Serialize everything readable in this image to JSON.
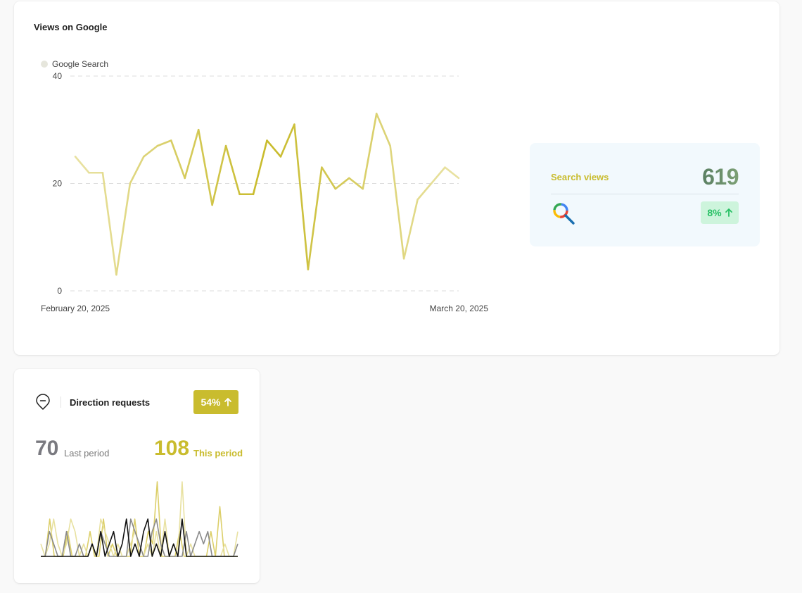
{
  "views_card": {
    "title": "Views on Google",
    "legend": "Google Search",
    "search_views_label": "Search views",
    "search_views_value": "619",
    "change_percent": "8%",
    "change_direction": "up-arrow-icon"
  },
  "direction_card": {
    "title": "Direction requests",
    "change_percent": "54%",
    "change_direction": "up-arrow-icon",
    "last_period_value": "70",
    "last_period_label": "Last period",
    "this_period_value": "108",
    "this_period_label": "This period",
    "icon": "map-pin-icon"
  },
  "colors": {
    "accent": "#c9bc2e",
    "accent_light": "#e8e1a0",
    "accent_mid": "#dccf6a",
    "value_gradient_start": "#5b8063",
    "value_gradient_end": "#7ca075",
    "badge_green_bg": "#cdf4dc",
    "badge_green_text": "#27c065",
    "gray_value": "#7a7a80",
    "black_line": "#111111",
    "gray_line": "#8a8a8a"
  },
  "chart_data": [
    {
      "type": "line",
      "title": "Views on Google",
      "legend": [
        "Google Search"
      ],
      "legend_position": "top-left",
      "grid": true,
      "ylim": [
        0,
        40
      ],
      "yticks": [
        0,
        20,
        40
      ],
      "x_tick_labels": [
        "February 20, 2025",
        "March 20, 2025"
      ],
      "series": [
        {
          "name": "Google Search",
          "values": [
            25,
            22,
            22,
            3,
            20,
            25,
            27,
            28,
            21,
            30,
            16,
            27,
            18,
            18,
            28,
            25,
            31,
            4,
            23,
            19,
            21,
            19,
            33,
            27,
            6,
            17,
            20,
            23,
            21
          ]
        }
      ]
    },
    {
      "type": "line",
      "title": "",
      "series": [
        {
          "values": [
            0,
            0,
            3,
            0,
            0,
            0,
            2,
            0,
            0,
            0,
            0,
            2,
            0,
            0,
            3,
            0,
            1,
            0,
            0,
            0,
            0,
            3,
            0,
            0,
            2,
            1,
            6,
            0,
            0,
            0,
            0,
            2,
            0,
            0,
            0,
            0,
            0,
            0,
            2,
            0,
            4,
            0,
            0,
            0,
            0
          ]
        },
        {
          "values": [
            1,
            0,
            1,
            3,
            1,
            0,
            1,
            3,
            2,
            0,
            1,
            0,
            1,
            0,
            3,
            2,
            1,
            0,
            1,
            0,
            0,
            1,
            2,
            1,
            0,
            1,
            0,
            2,
            0,
            3,
            0,
            1,
            0,
            6,
            0,
            1,
            0,
            0,
            0,
            0,
            0,
            0,
            0,
            1,
            0,
            0,
            2
          ]
        },
        {
          "values": [
            0,
            0,
            2,
            1,
            0,
            0,
            2,
            0,
            0,
            1,
            0,
            0,
            1,
            0,
            2,
            1,
            0,
            0,
            0,
            0,
            0,
            3,
            2,
            1,
            0,
            0,
            2,
            3,
            1,
            0,
            0,
            0,
            0,
            0,
            2,
            0,
            1,
            2,
            1,
            2,
            0,
            0,
            0,
            0,
            0,
            0,
            1
          ]
        },
        {
          "values": [
            0,
            0,
            0,
            0,
            0,
            0,
            0,
            0,
            0,
            0,
            0,
            0,
            1,
            0,
            2,
            0,
            1,
            2,
            0,
            1,
            3,
            0,
            1,
            0,
            2,
            3,
            0,
            1,
            0,
            2,
            0,
            1,
            0,
            3,
            0,
            0,
            0,
            0,
            0,
            0,
            0,
            0,
            0,
            0,
            0,
            0,
            0
          ]
        }
      ]
    }
  ]
}
